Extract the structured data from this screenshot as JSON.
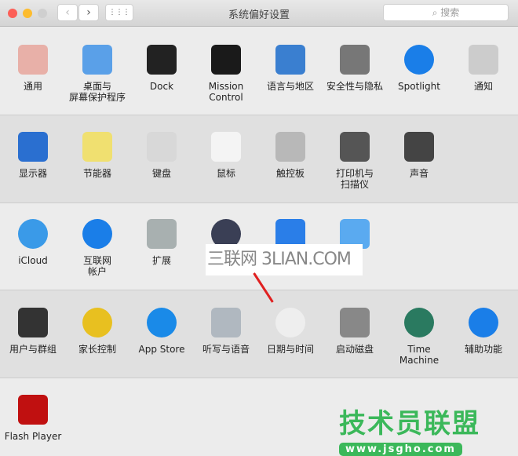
{
  "window": {
    "title": "系统偏好设置",
    "search_placeholder": "搜索",
    "back": "‹",
    "forward": "›",
    "grid": "⋮⋮⋮"
  },
  "rows": [
    [
      {
        "label": "通用",
        "icon": "general-icon",
        "color": "#e8b0a8"
      },
      {
        "label": "桌面与\n屏幕保护程序",
        "icon": "desktop-icon",
        "color": "#5aa0e8"
      },
      {
        "label": "Dock",
        "icon": "dock-icon",
        "color": "#222222"
      },
      {
        "label": "Mission\nControl",
        "icon": "mission-control-icon",
        "color": "#1a1a1a"
      },
      {
        "label": "语言与地区",
        "icon": "flag-icon",
        "color": "#3a7fd0"
      },
      {
        "label": "安全性与隐私",
        "icon": "security-house-icon",
        "color": "#777777"
      },
      {
        "label": "Spotlight",
        "icon": "spotlight-icon",
        "color": "#1a7ee8"
      },
      {
        "label": "通知",
        "icon": "notifications-icon",
        "color": "#cccccc"
      }
    ],
    [
      {
        "label": "显示器",
        "icon": "display-icon",
        "color": "#2a6fd0"
      },
      {
        "label": "节能器",
        "icon": "bulb-icon",
        "color": "#f0e070"
      },
      {
        "label": "键盘",
        "icon": "keyboard-icon",
        "color": "#d8d8d8"
      },
      {
        "label": "鼠标",
        "icon": "mouse-icon",
        "color": "#f4f4f4"
      },
      {
        "label": "触控板",
        "icon": "trackpad-icon",
        "color": "#b8b8b8"
      },
      {
        "label": "打印机与\n扫描仪",
        "icon": "printer-icon",
        "color": "#555555"
      },
      {
        "label": "声音",
        "icon": "speaker-icon",
        "color": "#444444"
      }
    ],
    [
      {
        "label": "iCloud",
        "icon": "icloud-icon",
        "color": "#3a9ae8"
      },
      {
        "label": "互联网\n帐户",
        "icon": "at-icon",
        "color": "#1a7ee8"
      },
      {
        "label": "扩展",
        "icon": "puzzle-icon",
        "color": "#a8b0b0"
      },
      {
        "label": "",
        "icon": "network-globe-icon",
        "color": "#3a3f55"
      },
      {
        "label": "",
        "icon": "bluetooth-icon",
        "color": "#2a7ee8"
      },
      {
        "label": "",
        "icon": "sharing-folder-icon",
        "color": "#5aaaf0"
      }
    ],
    [
      {
        "label": "用户与群组",
        "icon": "users-icon",
        "color": "#333333"
      },
      {
        "label": "家长控制",
        "icon": "parental-icon",
        "color": "#e8c020"
      },
      {
        "label": "App Store",
        "icon": "appstore-icon",
        "color": "#1a8ae8"
      },
      {
        "label": "听写与语音",
        "icon": "microphone-icon",
        "color": "#b0b8c0"
      },
      {
        "label": "日期与时间",
        "icon": "clock-icon",
        "color": "#eeeeee"
      },
      {
        "label": "启动磁盘",
        "icon": "disk-icon",
        "color": "#888888"
      },
      {
        "label": "Time Machine",
        "icon": "time-machine-icon",
        "color": "#2a7a60"
      },
      {
        "label": "辅助功能",
        "icon": "accessibility-icon",
        "color": "#1a7ee8"
      }
    ],
    [
      {
        "label": "Flash Player",
        "icon": "flash-icon",
        "color": "#c01010"
      }
    ]
  ],
  "watermark": "三联网 3LIAN.COM",
  "logo": {
    "text": "技术员联盟",
    "url": "www.jsgho.com"
  }
}
